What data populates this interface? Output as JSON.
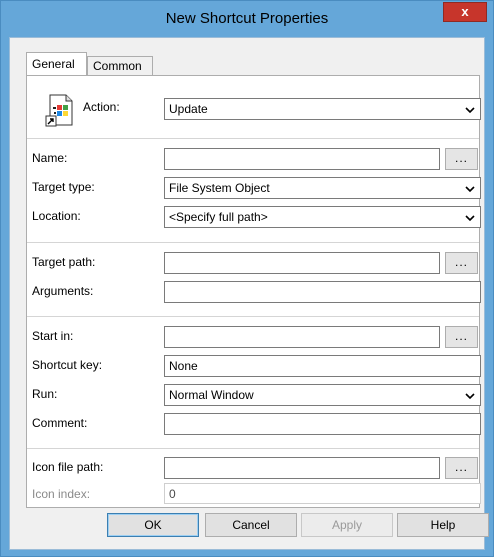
{
  "window": {
    "title": "New Shortcut Properties",
    "close_glyph": "x"
  },
  "tabs": [
    {
      "label": "General",
      "active": true
    },
    {
      "label": "Common",
      "active": false
    }
  ],
  "general": {
    "action": {
      "label": "Action:",
      "value": "Update"
    },
    "name": {
      "label": "Name:",
      "value": "",
      "browse": "..."
    },
    "target_type": {
      "label": "Target type:",
      "value": "File System Object"
    },
    "location": {
      "label": "Location:",
      "value": "<Specify full path>"
    },
    "target_path": {
      "label": "Target path:",
      "value": "",
      "browse": "..."
    },
    "arguments": {
      "label": "Arguments:",
      "value": ""
    },
    "start_in": {
      "label": "Start in:",
      "value": "",
      "browse": "..."
    },
    "shortcut_key": {
      "label": "Shortcut key:",
      "value": "None"
    },
    "run": {
      "label": "Run:",
      "value": "Normal Window"
    },
    "comment": {
      "label": "Comment:",
      "value": ""
    },
    "icon_file_path": {
      "label": "Icon file path:",
      "value": "",
      "browse": "..."
    },
    "icon_index": {
      "label": "Icon index:",
      "value": "0"
    }
  },
  "buttons": {
    "ok": "OK",
    "cancel": "Cancel",
    "apply": "Apply",
    "help": "Help"
  },
  "colors": {
    "titlebar": "#65a7d9",
    "close": "#c7352b",
    "panel": "#ffffff",
    "dialog_bg": "#f0f0f0"
  }
}
